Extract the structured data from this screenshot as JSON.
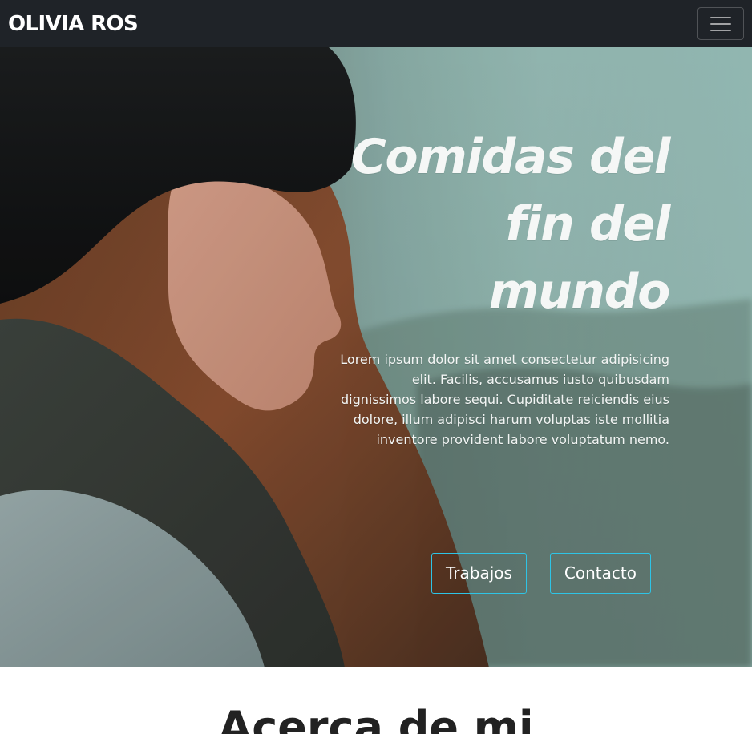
{
  "navbar": {
    "brand": "OLIVIA ROS",
    "toggle_icon": "hamburger-icon"
  },
  "hero": {
    "title_lines": [
      "Comidas del",
      "fin del",
      "mundo"
    ],
    "paragraph": "Lorem ipsum dolor sit amet consectetur adipisicing elit. Facilis, accusamus iusto quibusdam dignissimos labore sequi. Cupiditate reiciendis eius dolore, illum adipisci harum voluptas iste mollitia inventore provident labore voluptatum nemo.",
    "buttons": {
      "works": "Trabajos",
      "contact": "Contacto"
    }
  },
  "about": {
    "title": "Acerca de mi"
  },
  "colors": {
    "navbar_bg": "#1f2328",
    "accent_border": "#2ec4e6",
    "hero_text": "#f5f7f6"
  }
}
